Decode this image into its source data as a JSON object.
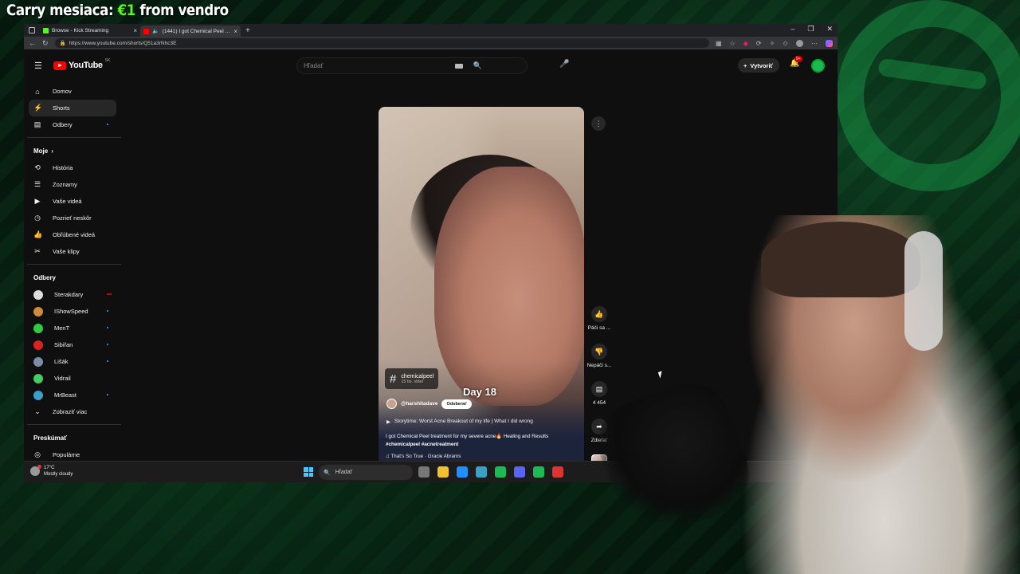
{
  "overlay": {
    "title_prefix": "Carry mesiaca:",
    "amount": "€1",
    "title_suffix": "from vendro"
  },
  "browser": {
    "tabs": [
      {
        "label": "Browse - Kick Streaming",
        "favicon_color": "#53fc18"
      },
      {
        "label": "(1441) I got Chemical Peel treatment",
        "favicon_color": "#ff0000",
        "active": true
      }
    ],
    "url": "https://www.youtube.com/shorts/Q51a3rNhc3E"
  },
  "youtube": {
    "logo": "YouTube",
    "logo_region": "SK",
    "search_placeholder": "Hľadať",
    "create_label": "Vytvoriť",
    "notif_count": "9+",
    "sidebar": {
      "main": [
        {
          "label": "Domov",
          "icon": "home-icon",
          "glyph": "⌂"
        },
        {
          "label": "Shorts",
          "icon": "shorts-icon",
          "glyph": "⚡",
          "active": true
        },
        {
          "label": "Odbery",
          "icon": "subscriptions-icon",
          "glyph": "▤"
        }
      ],
      "you_heading": "Moje",
      "you": [
        {
          "label": "História",
          "icon": "history-icon",
          "glyph": "⟲"
        },
        {
          "label": "Zoznamy",
          "icon": "playlists-icon",
          "glyph": "☰"
        },
        {
          "label": "Vaše videá",
          "icon": "your-videos-icon",
          "glyph": "▶"
        },
        {
          "label": "Pozrieť neskôr",
          "icon": "watch-later-icon",
          "glyph": "◷"
        },
        {
          "label": "Obľúbené videá",
          "icon": "liked-videos-icon",
          "glyph": "👍"
        },
        {
          "label": "Vaše klipy",
          "icon": "clips-icon",
          "glyph": "✂"
        }
      ],
      "subs_heading": "Odbery",
      "subs": [
        {
          "label": "Sterakdary",
          "color": "#ddd",
          "live": true
        },
        {
          "label": "IShowSpeed",
          "color": "#d08a3c"
        },
        {
          "label": "MenT",
          "color": "#2ecc40"
        },
        {
          "label": "Sibiřan",
          "color": "#d22"
        },
        {
          "label": "Lišák",
          "color": "#7a8fa6"
        },
        {
          "label": "Vidrail",
          "color": "#4c6"
        },
        {
          "label": "MrBeast",
          "color": "#3aa0c8"
        }
      ],
      "show_more": "Zobraziť viac",
      "explore_heading": "Preskúmať",
      "explore": [
        {
          "label": "Populárne",
          "icon": "trending-icon",
          "glyph": "◎"
        }
      ]
    },
    "short": {
      "hashtag": "chemicalpeel",
      "hashtag_count": "15 tis. videí",
      "overlay_text": "Day 18",
      "channel": "@harshitadave",
      "subscribe_label": "Odoberať",
      "story": "Storytime: Worst Acne Breakout of my life | What I did wrong",
      "description": "I got Chemical Peel treatment for my severe acne🔥 Healing and Results",
      "tags": "#chemicalpeel #acnetreatment",
      "music": "That's So True · Gracie Abrams",
      "progress": 0.38
    },
    "actions": {
      "like": "Páči sa ...",
      "dislike": "Nepáči s...",
      "comments": "4 454",
      "share": "Zdieľať"
    }
  },
  "taskbar": {
    "temp": "17°C",
    "weather": "Mostly cloudy",
    "search": "Hľadať",
    "apps": [
      "#777",
      "#f2c12e",
      "#1e90ff",
      "#3aa0c8",
      "#1db954",
      "#5865f2",
      "#1db954",
      "#d33"
    ]
  }
}
